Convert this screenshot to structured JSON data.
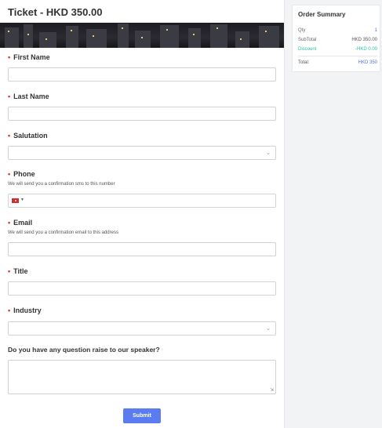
{
  "ticket": {
    "title": "Ticket - HKD 350.00"
  },
  "colors": {
    "accent": "#5b7cf1",
    "required": "#d62b2b",
    "discount": "#2bbfa4",
    "link": "#4f73d9"
  },
  "fields": {
    "first_name": {
      "label": "First Name"
    },
    "last_name": {
      "label": "Last Name"
    },
    "salutation": {
      "label": "Salutation",
      "value": ""
    },
    "phone": {
      "label": "Phone",
      "help": "We will send you a confirmation sms to this number",
      "country": "HK"
    },
    "email": {
      "label": "Email",
      "help": "We will send you a confirmation email to this address"
    },
    "title": {
      "label": "Title"
    },
    "industry": {
      "label": "Industry",
      "value": ""
    },
    "question": {
      "label": "Do you have any question raise to our speaker?"
    }
  },
  "submit_label": "Submit",
  "summary": {
    "title": "Order Summary",
    "qty_label": "Qty",
    "qty_value": "1",
    "subtotal_label": "SubTotal",
    "subtotal_value": "HKD 350.00",
    "discount_label": "Discount",
    "discount_value": "-HKD 0.00",
    "total_label": "Total:",
    "total_value": "HKD 350"
  }
}
